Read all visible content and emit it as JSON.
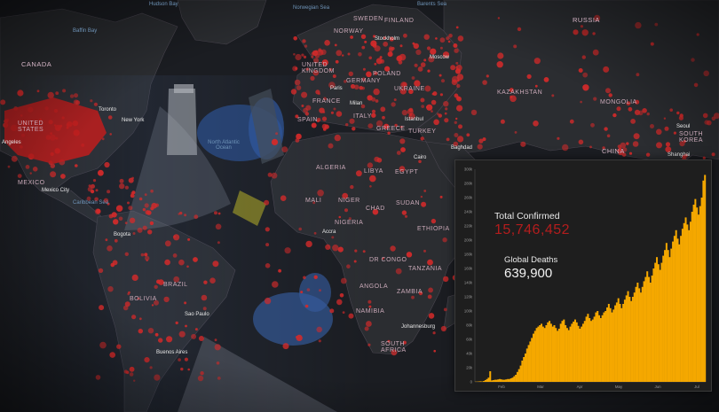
{
  "map": {
    "countries": [
      "CANADA",
      "UNITED STATES",
      "MEXICO",
      "BRAZIL",
      "BOLIVIA",
      "SWEDEN",
      "FINLAND",
      "NORWAY",
      "RUSSIA",
      "UNITED KINGDOM",
      "GERMANY",
      "POLAND",
      "FRANCE",
      "SPAIN",
      "ITALY",
      "UKRAINE",
      "KAZAKHSTAN",
      "MONGOLIA",
      "CHINA",
      "GREECE",
      "TURKEY",
      "ALGERIA",
      "LIBYA",
      "EGYPT",
      "MALI",
      "NIGER",
      "CHAD",
      "SUDAN",
      "NIGERIA",
      "ETHIOPIA",
      "DR CONGO",
      "TANZANIA",
      "ANGOLA",
      "ZAMBIA",
      "NAMIBIA",
      "SOUTH AFRICA",
      "SOUTH KOREA"
    ],
    "cities": [
      "Toronto",
      "New York",
      "Mexico City",
      "Bogota",
      "Sao Paulo",
      "Buenos Aires",
      "Stockholm",
      "Moscow",
      "Paris",
      "Milan",
      "Istanbul",
      "Baghdad",
      "Cairo",
      "Accra",
      "Johannesburg",
      "Shanghai",
      "Seoul",
      "Angeles"
    ],
    "oceans": [
      "Baffin Bay",
      "Hudson Bay",
      "North Atlantic Ocean",
      "Caribbean Sea",
      "Norwegian Sea",
      "Barents Sea"
    ]
  },
  "panel": {
    "confirmed_label": "Total Confirmed",
    "confirmed_value": "15,746,452",
    "deaths_label": "Global Deaths",
    "deaths_value": "639,900"
  },
  "colors": {
    "confirmed": "#b31d1d",
    "bars": "#f5a800",
    "dots": "#d42a2a",
    "land": "#2b2d31",
    "water": "#1b1d22"
  },
  "chart_data": {
    "type": "bar",
    "title": "",
    "xlabel": "",
    "ylabel": "",
    "x_ticks": [
      "Feb",
      "Mar",
      "Apr",
      "May",
      "Jun",
      "Jul"
    ],
    "y_ticks": [
      "0",
      "20k",
      "40k",
      "60k",
      "80k",
      "100k",
      "120k",
      "140k",
      "160k",
      "180k",
      "200k",
      "220k",
      "240k",
      "260k",
      "280k",
      "300k"
    ],
    "ylim": [
      0,
      300000
    ],
    "values": [
      300,
      400,
      600,
      800,
      500,
      1200,
      2500,
      4000,
      6000,
      15000,
      2000,
      2500,
      3000,
      3000,
      3500,
      4000,
      3500,
      3000,
      3000,
      3500,
      4000,
      4000,
      5000,
      6000,
      8000,
      10000,
      14000,
      18000,
      23000,
      30000,
      35000,
      40000,
      47000,
      52000,
      57000,
      62000,
      68000,
      72000,
      76000,
      78000,
      80000,
      82000,
      78000,
      76000,
      80000,
      84000,
      86000,
      82000,
      78000,
      80000,
      76000,
      72000,
      75000,
      82000,
      86000,
      88000,
      80000,
      76000,
      73000,
      78000,
      82000,
      85000,
      88000,
      84000,
      79000,
      75000,
      78000,
      82000,
      86000,
      92000,
      96000,
      90000,
      86000,
      88000,
      92000,
      98000,
      100000,
      94000,
      90000,
      94000,
      98000,
      100000,
      105000,
      110000,
      104000,
      98000,
      102000,
      108000,
      112000,
      118000,
      110000,
      104000,
      110000,
      116000,
      122000,
      128000,
      120000,
      114000,
      120000,
      126000,
      134000,
      140000,
      132000,
      126000,
      134000,
      142000,
      148000,
      156000,
      148000,
      140000,
      150000,
      160000,
      168000,
      176000,
      166000,
      158000,
      168000,
      178000,
      186000,
      196000,
      186000,
      176000,
      188000,
      198000,
      206000,
      214000,
      202000,
      194000,
      206000,
      216000,
      224000,
      232000,
      222000,
      214000,
      226000,
      240000,
      250000,
      258000,
      246000,
      236000,
      248000,
      260000,
      284000,
      292000
    ]
  }
}
